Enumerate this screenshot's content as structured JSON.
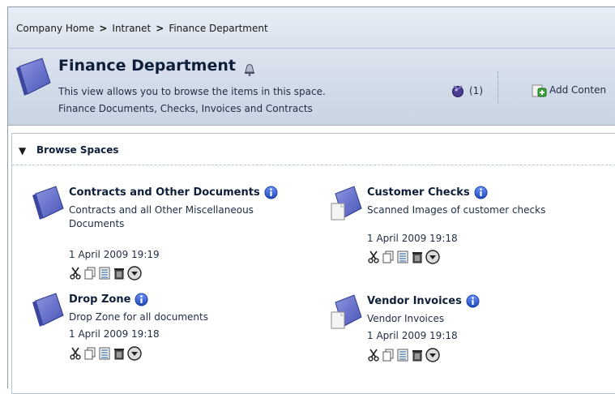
{
  "breadcrumb": {
    "items": [
      "Company Home",
      "Intranet",
      "Finance Department"
    ],
    "separator": ">"
  },
  "header": {
    "title": "Finance Department",
    "description": "This view allows you to browse the items in this space.",
    "subtitle": "Finance Documents, Checks, Invoices and Contracts",
    "workflow_count": "(1)",
    "add_content_label": "Add Conten"
  },
  "browse": {
    "title": "Browse Spaces",
    "spaces": [
      {
        "name": "Contracts and Other Documents",
        "description": "Contracts and all Other Miscellaneous Documents",
        "date": "1 April 2009 19:19",
        "icon": "folder-space-icon"
      },
      {
        "name": "Customer Checks",
        "description": "Scanned Images of customer checks",
        "date": "1 April 2009 19:18",
        "icon": "folder-document-space-icon"
      },
      {
        "name": "Drop Zone",
        "description": "Drop Zone for all documents",
        "date": "1 April 2009 19:18",
        "icon": "folder-space-icon"
      },
      {
        "name": "Vendor Invoices",
        "description": "Vendor Invoices",
        "date": "1 April 2009 19:18",
        "icon": "folder-document-space-icon"
      }
    ]
  },
  "colors": {
    "title": "#0e1f3a",
    "header_band": "#cfd9e6",
    "info_blue": "#2a55c8"
  }
}
